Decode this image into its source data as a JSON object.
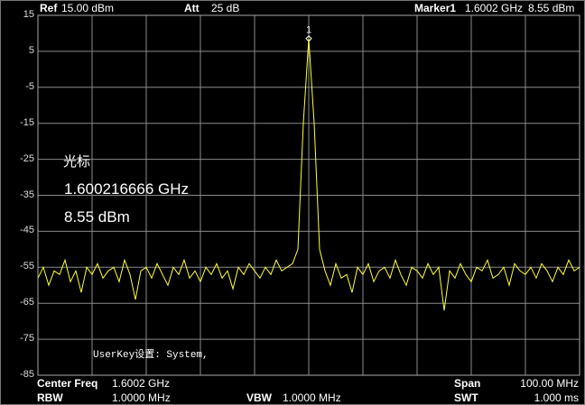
{
  "header": {
    "ref_label": "Ref",
    "ref_value": "15.00 dBm",
    "att_label": "Att",
    "att_value": "25 dB",
    "marker_label": "Marker1",
    "marker_freq": "1.6002 GHz",
    "marker_level": "8.55 dBm"
  },
  "overlay": {
    "title": "光标",
    "freq": "1.600216666 GHz",
    "level": "8.55 dBm",
    "userkey": "UserKey设置:  System,"
  },
  "footer": {
    "center_label": "Center Freq",
    "center_value": "1.6002 GHz",
    "span_label": "Span",
    "span_value": "100.00 MHz",
    "rbw_label": "RBW",
    "rbw_value": "1.0000 MHz",
    "vbw_label": "VBW",
    "vbw_value": "1.0000 MHz",
    "swt_label": "SWT",
    "swt_value": "1.000 ms"
  },
  "colors": {
    "trace": "#ffff33",
    "grid": "#8a8a8a",
    "background": "#000000"
  },
  "chart_data": {
    "type": "line",
    "xlabel": "",
    "ylabel": "",
    "xlim_mhz": [
      1550.2,
      1650.2
    ],
    "ylim": [
      -85,
      15
    ],
    "yticks": [
      "15",
      "5",
      "-5",
      "-15",
      "-25",
      "-35",
      "-45",
      "-55",
      "-65",
      "-75",
      "-85"
    ],
    "grid": true,
    "x_divisions": 10,
    "marker": {
      "label": "1",
      "freq_mhz": 1600.2,
      "level_dbm": 8.55
    },
    "series": [
      {
        "x_start_mhz": 1550.2,
        "x_step_mhz": 1.0,
        "values": [
          -58,
          -55,
          -60,
          -56,
          -57,
          -53,
          -59,
          -56,
          -62,
          -55,
          -57,
          -54,
          -58,
          -56,
          -55,
          -59,
          -53,
          -57,
          -64,
          -56,
          -55,
          -58,
          -54,
          -57,
          -60,
          -55,
          -57,
          -53,
          -58,
          -56,
          -59,
          -55,
          -57,
          -54,
          -58,
          -56,
          -61,
          -55,
          -57,
          -54,
          -56,
          -58,
          -55,
          -57,
          -53,
          -56,
          -55,
          -54,
          -50,
          -15,
          8.55,
          -15,
          -50,
          -56,
          -60,
          -54,
          -58,
          -57,
          -62,
          -55,
          -57,
          -54,
          -59,
          -56,
          -55,
          -58,
          -53,
          -57,
          -60,
          -55,
          -56,
          -58,
          -54,
          -57,
          -55,
          -67,
          -56,
          -58,
          -54,
          -57,
          -59,
          -55,
          -56,
          -53,
          -58,
          -57,
          -55,
          -60,
          -54,
          -56,
          -57,
          -55,
          -58,
          -54,
          -56,
          -59,
          -55,
          -57,
          -53,
          -56,
          -55
        ]
      }
    ]
  }
}
